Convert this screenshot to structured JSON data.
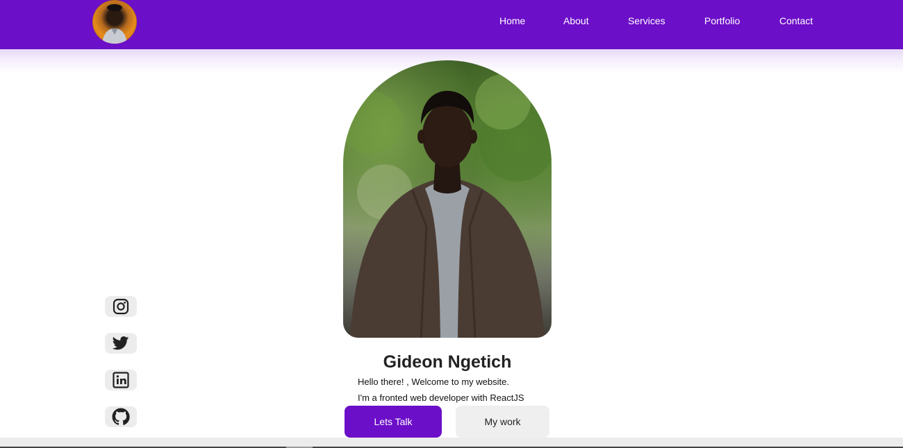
{
  "brand": {
    "logo_icon": "profile-avatar-icon"
  },
  "nav": {
    "items": [
      {
        "label": "Home"
      },
      {
        "label": "About"
      },
      {
        "label": "Services"
      },
      {
        "label": "Portfolio"
      },
      {
        "label": "Contact"
      }
    ]
  },
  "hero": {
    "portrait_icon": "profile-photo",
    "name": "Gideon Ngetich",
    "greeting": "Hello there! , Welcome to my website.",
    "tagline": "I'm a fronted web developer with ReactJS",
    "primary_button": "Lets Talk",
    "secondary_button": "My work"
  },
  "social": [
    {
      "icon": "instagram-icon"
    },
    {
      "icon": "twitter-icon"
    },
    {
      "icon": "linkedin-icon"
    },
    {
      "icon": "github-icon"
    }
  ],
  "colors": {
    "accent": "#6c0fc8",
    "secondary_button_bg": "#efefef",
    "social_bg": "#ececec"
  }
}
